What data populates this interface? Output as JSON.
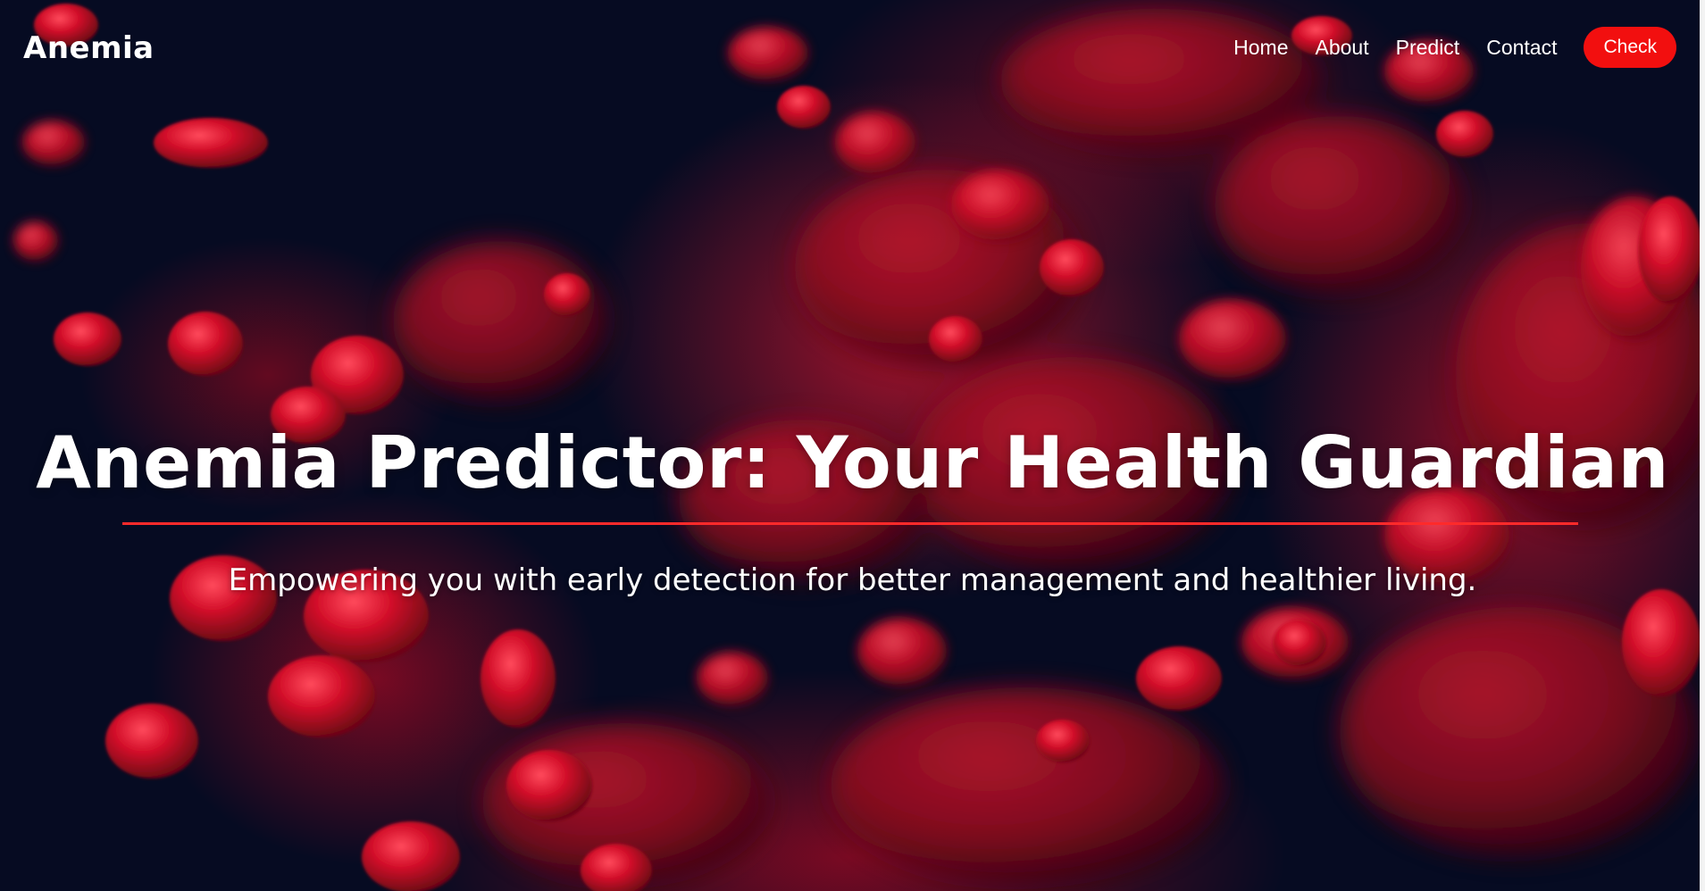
{
  "brand": {
    "logo": "Anemia"
  },
  "nav": {
    "items": [
      {
        "label": "Home"
      },
      {
        "label": "About"
      },
      {
        "label": "Predict"
      },
      {
        "label": "Contact"
      }
    ],
    "cta_label": "Check"
  },
  "hero": {
    "title": "Anemia Predictor: Your Health Guardian",
    "subtitle": "Empowering you with early detection for better management and healthier living."
  },
  "colors": {
    "accent": "#f20f0f",
    "rule": "#ff2a2a",
    "background": "#060b22",
    "text": "#ffffff"
  }
}
